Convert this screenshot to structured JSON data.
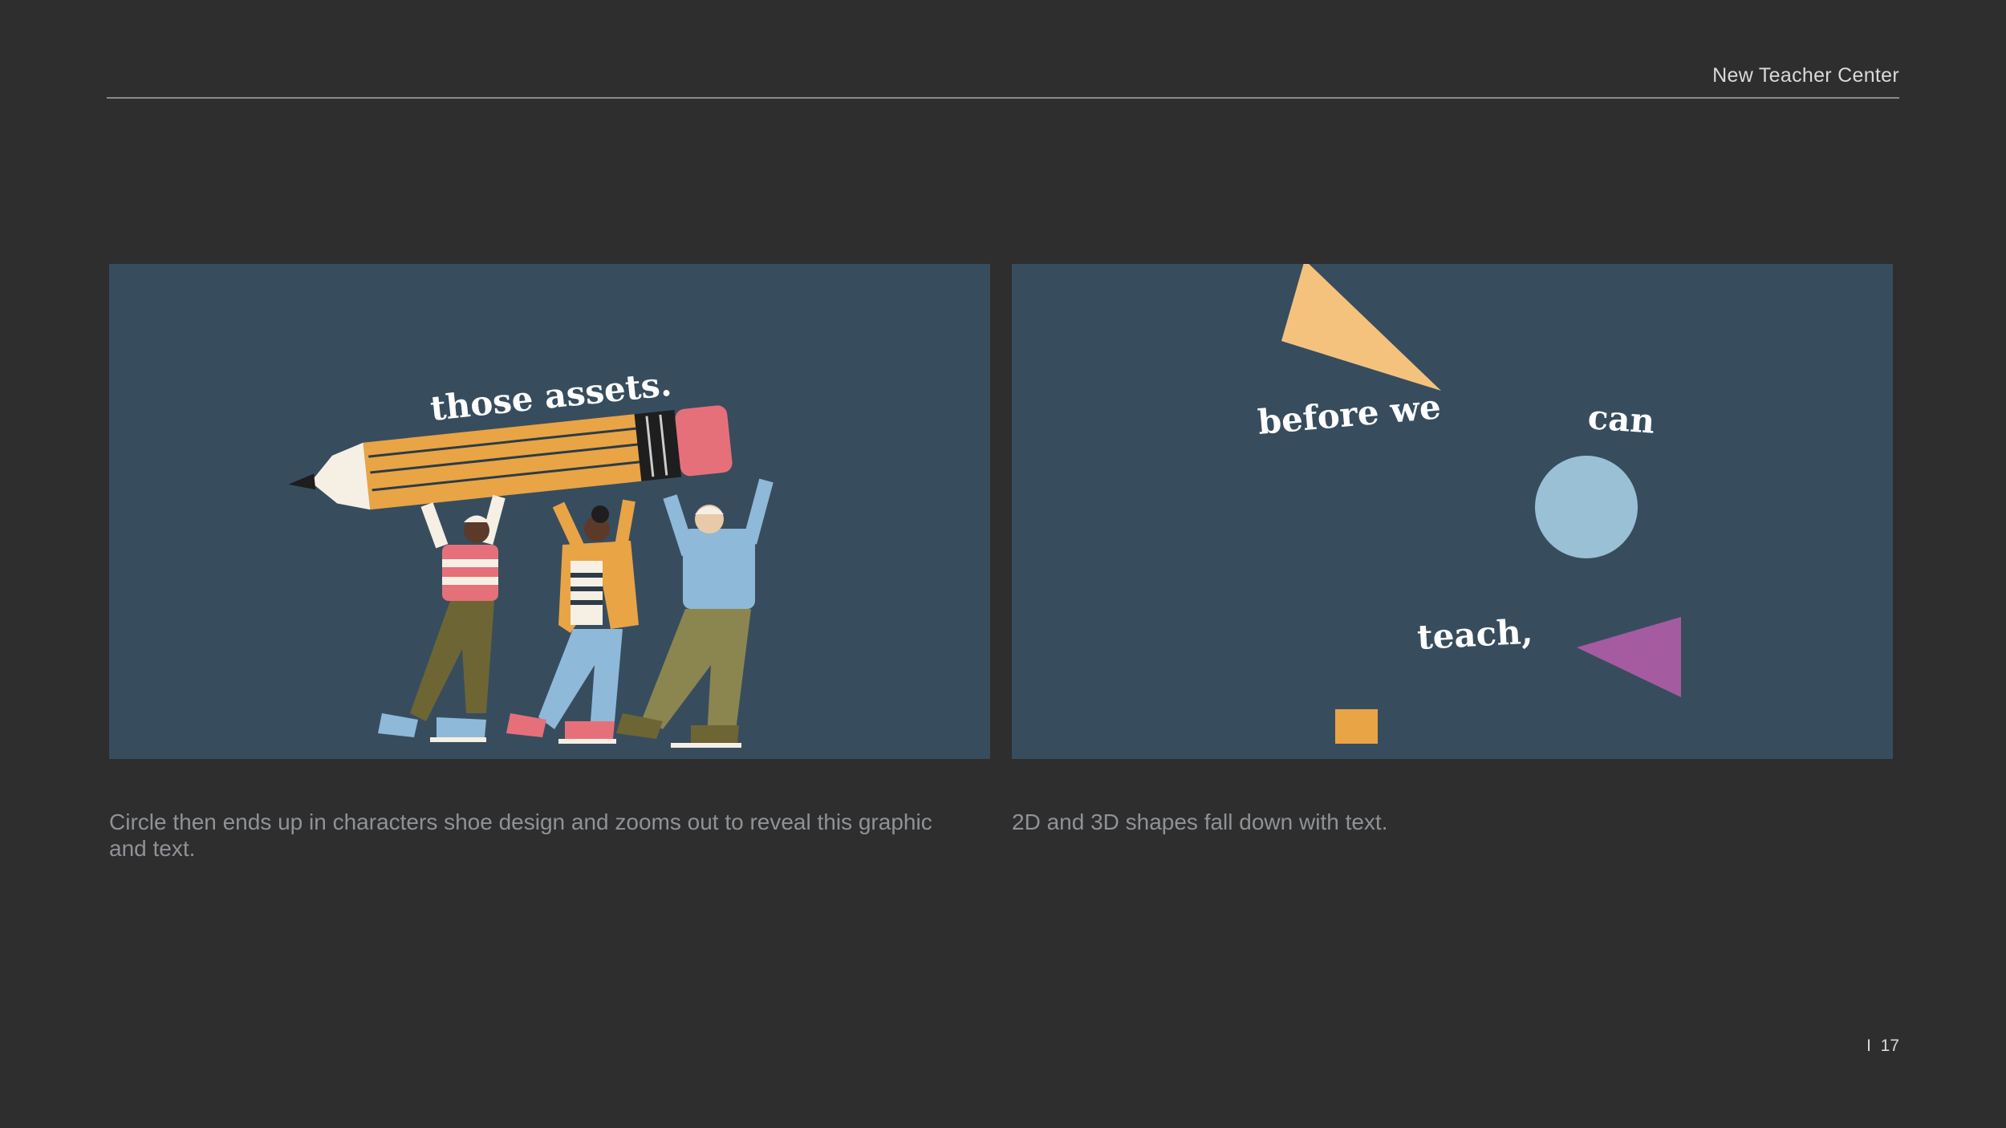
{
  "header": {
    "brand": "New Teacher Center"
  },
  "panels": {
    "left": {
      "text": "those assets.",
      "caption": "Circle then ends up in characters shoe design and zooms out to reveal this graphic and text."
    },
    "right": {
      "words": [
        "before we",
        "can",
        "teach,"
      ],
      "caption": "2D and 3D shapes fall down with text."
    }
  },
  "footer": {
    "separator": "I",
    "page_number": "17"
  },
  "colors": {
    "background": "#2e2e2e",
    "panel": "#374d5e",
    "pencil_body": "#e9a445",
    "pencil_eraser": "#e6707a",
    "triangle": "#f5c27e",
    "circle": "#9ac0d6",
    "purple_triangle": "#a55ba0",
    "square": "#e9a445"
  }
}
